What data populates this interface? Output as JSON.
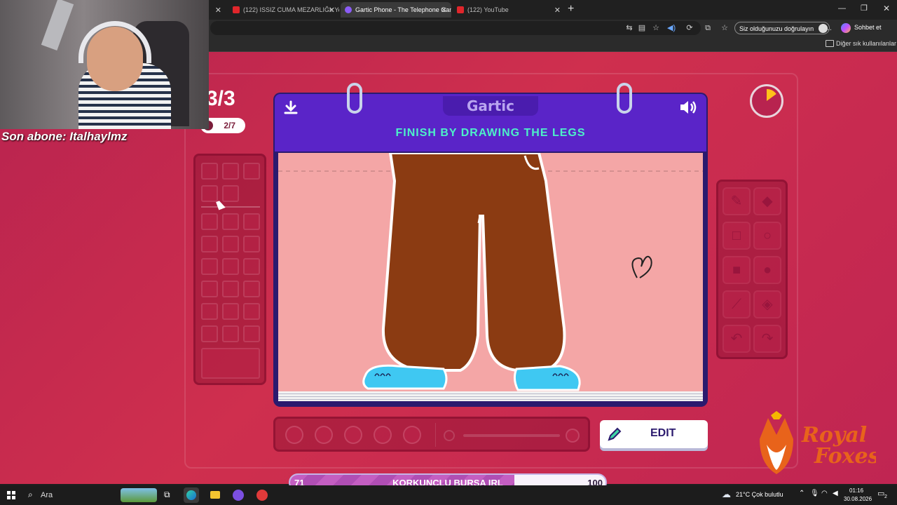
{
  "browser": {
    "tabs": [
      {
        "label": "(122) ISSIZ CUMA MEZARLIĞI: Ye",
        "active": false
      },
      {
        "label": "Gartic Phone - The Telephone Gam",
        "active": true
      },
      {
        "label": "(122) YouTube",
        "active": false
      }
    ],
    "new_tab_symbol": "+",
    "verify_label": "Siz olduğunuzu doğrulayın",
    "chat_label": "Sohbet et",
    "bookmarks_label": "Diğer sık kullanılanlar"
  },
  "stream": {
    "last_sub": "Son abone: Italhaylmz"
  },
  "game": {
    "round": "3/3",
    "players": "2/7",
    "logo": "Gartic",
    "instruction": "FINISH BY DRAWING THE LEGS",
    "edit_label": "EDIT",
    "timer_fraction": 0.15,
    "accent_color": "#5a24c8",
    "instruction_color": "#4df0c8"
  },
  "progress_bar": {
    "left_value": "71",
    "title": "KORKUNÇLU BURSA IRL",
    "right_value": "100",
    "fraction": 0.71
  },
  "watermark": {
    "text_line1": "Royal",
    "text_line2": "Foxes"
  },
  "taskbar": {
    "search_label": "Ara",
    "weather": "21°C  Çok bulutlu",
    "time": "01:16",
    "date": "30.08.2026",
    "notification_count": "2"
  }
}
